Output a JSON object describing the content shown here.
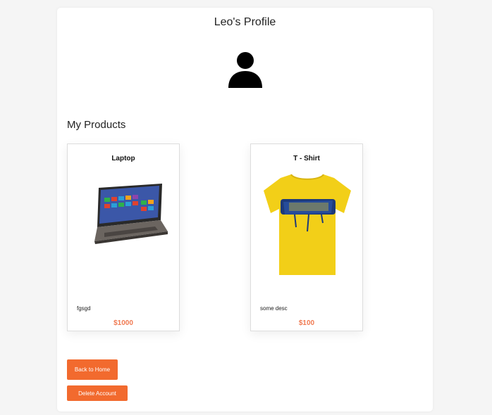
{
  "profile": {
    "title": "Leo's Profile",
    "avatar_icon": "user-icon"
  },
  "products_section": {
    "title": "My Products",
    "items": [
      {
        "name": "Laptop",
        "image_icon": "laptop-image",
        "description": "fgsgd",
        "price": "$1000"
      },
      {
        "name": "T - Shirt",
        "image_icon": "tshirt-image",
        "description": "some desc",
        "price": "$100"
      }
    ]
  },
  "actions": {
    "back_home_label": "Back to Home",
    "delete_account_label": "Delete Account"
  },
  "colors": {
    "accent": "#f26a2e",
    "price": "#f07a52",
    "background": "#f5f5f5"
  }
}
